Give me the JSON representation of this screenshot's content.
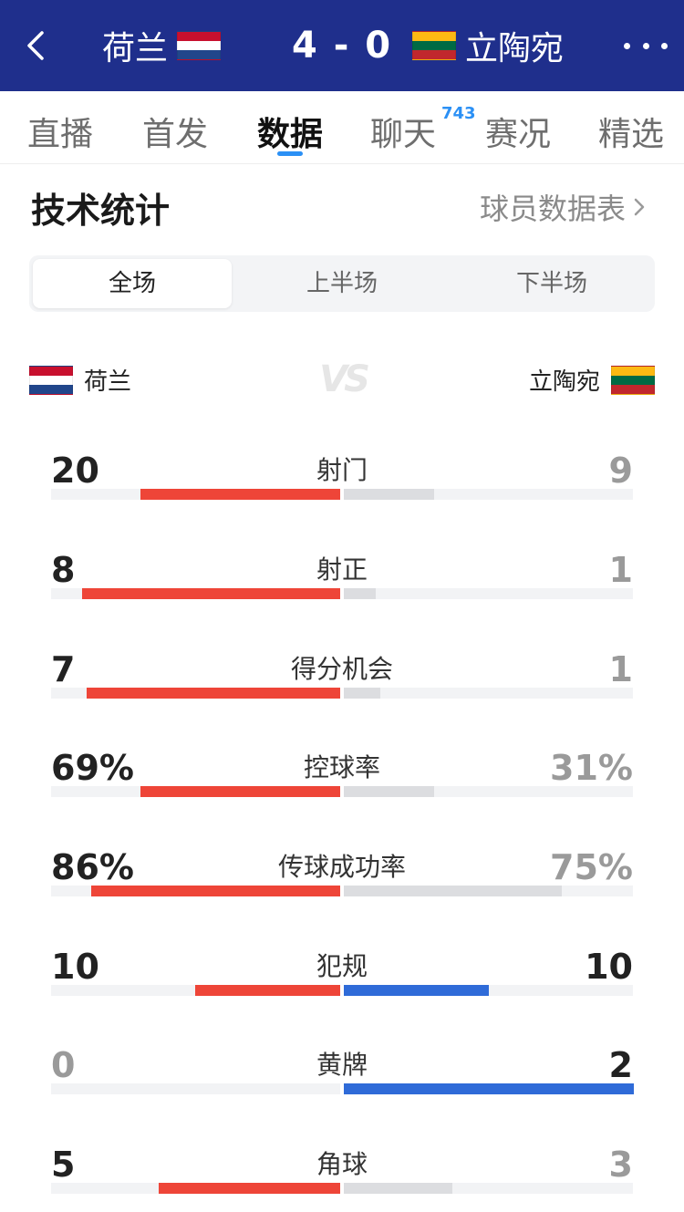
{
  "header": {
    "home_team": "荷兰",
    "away_team": "立陶宛",
    "score": "4 - 0"
  },
  "tabs": [
    {
      "label": "直播"
    },
    {
      "label": "首发"
    },
    {
      "label": "数据"
    },
    {
      "label": "聊天"
    },
    {
      "label": "赛况"
    },
    {
      "label": "精选"
    }
  ],
  "chat_badge": "743",
  "active_tab": "数据",
  "section": {
    "title": "技术统计",
    "link": "球员数据表"
  },
  "segments": [
    {
      "label": "全场"
    },
    {
      "label": "上半场"
    },
    {
      "label": "下半场"
    }
  ],
  "active_segment": "全场",
  "teams": {
    "home": "荷兰",
    "away": "立陶宛",
    "vs": "VS"
  },
  "colors": {
    "header_bg": "#1f2f8c",
    "home_bar": "#ee4538",
    "away_bar_neutral": "#dcdde0",
    "highlight_bar": "#2f6bd8",
    "tab_accent": "#2b90f5"
  },
  "stats": [
    {
      "name": "射门",
      "home": "20",
      "away": "9",
      "home_frac": 0.69,
      "away_frac": 0.31,
      "home_color": "red",
      "away_color": "gray"
    },
    {
      "name": "射正",
      "home": "8",
      "away": "1",
      "home_frac": 0.89,
      "away_frac": 0.11,
      "home_color": "red",
      "away_color": "gray"
    },
    {
      "name": "得分机会",
      "home": "7",
      "away": "1",
      "home_frac": 0.875,
      "away_frac": 0.125,
      "home_color": "red",
      "away_color": "gray"
    },
    {
      "name": "控球率",
      "home": "69%",
      "away": "31%",
      "home_frac": 0.69,
      "away_frac": 0.31,
      "home_color": "red",
      "away_color": "gray"
    },
    {
      "name": "传球成功率",
      "home": "86%",
      "away": "75%",
      "home_frac": 0.86,
      "away_frac": 0.75,
      "home_color": "red",
      "away_color": "gray"
    },
    {
      "name": "犯规",
      "home": "10",
      "away": "10",
      "home_frac": 0.5,
      "away_frac": 0.5,
      "home_color": "red",
      "away_color": "blue"
    },
    {
      "name": "黄牌",
      "home": "0",
      "away": "2",
      "home_frac": 0.0,
      "away_frac": 1.0,
      "home_color": "red",
      "away_color": "blue"
    },
    {
      "name": "角球",
      "home": "5",
      "away": "3",
      "home_frac": 0.625,
      "away_frac": 0.375,
      "home_color": "red",
      "away_color": "gray"
    }
  ]
}
